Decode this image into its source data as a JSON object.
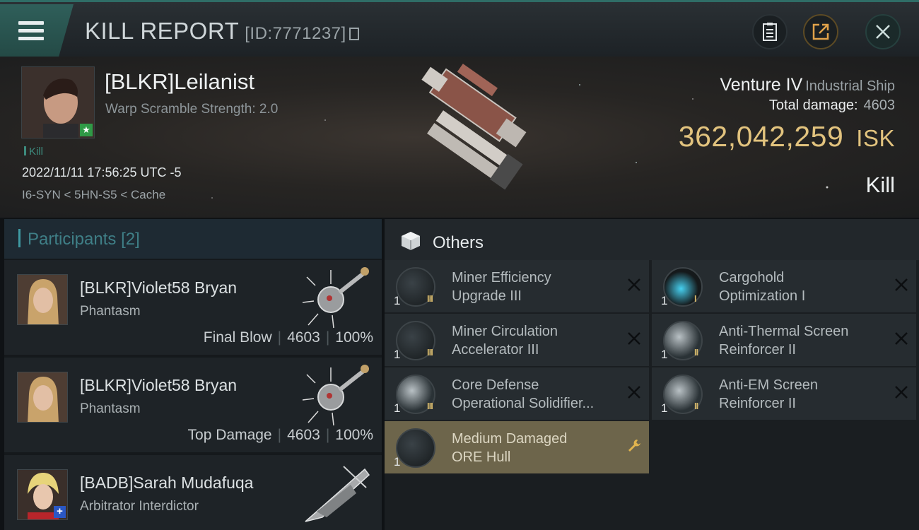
{
  "header": {
    "title": "KILL REPORT",
    "id_label": "[ID:7771237]"
  },
  "victim": {
    "name": "[BLKR]Leilanist",
    "warp_scramble": "Warp Scramble Strength: 2.0",
    "tag": "Kill",
    "datetime": "2022/11/11 17:56:25 UTC -5",
    "location": "I6-SYN < 5HN-S5 < Cache"
  },
  "ship": {
    "name": "Venture IV",
    "class": "Industrial Ship",
    "total_damage_label": "Total damage:",
    "total_damage": "4603",
    "isk_value": "362,042,259",
    "isk_unit": "ISK",
    "result": "Kill"
  },
  "participants": {
    "title": "Participants",
    "count": "[2]",
    "list": [
      {
        "name": "[BLKR]Violet58 Bryan",
        "ship": "Phantasm",
        "role": "Final Blow",
        "damage": "4603",
        "percent": "100%"
      },
      {
        "name": "[BLKR]Violet58 Bryan",
        "ship": "Phantasm",
        "role": "Top Damage",
        "damage": "4603",
        "percent": "100%"
      },
      {
        "name": "[BADB]Sarah Mudafuqa",
        "ship": "Arbitrator Interdictor"
      }
    ]
  },
  "others": {
    "title": "Others",
    "items": [
      {
        "line1": "Miner Efficiency",
        "line2": "Upgrade III",
        "qty": "1"
      },
      {
        "line1": "Cargohold",
        "line2": "Optimization I",
        "qty": "1"
      },
      {
        "line1": "Miner Circulation",
        "line2": "Accelerator III",
        "qty": "1"
      },
      {
        "line1": "Anti-Thermal Screen",
        "line2": "Reinforcer II",
        "qty": "1"
      },
      {
        "line1": "Core Defense",
        "line2": "Operational Solidifier...",
        "qty": "1"
      },
      {
        "line1": "Anti-EM Screen",
        "line2": "Reinforcer II",
        "qty": "1"
      },
      {
        "line1": "Medium Damaged",
        "line2": "ORE Hull",
        "qty": "1"
      }
    ]
  },
  "colors": {
    "accent_teal": "#2f6d66",
    "isk_gold": "#e2c37e",
    "damaged_item_bg": "#6d654b"
  },
  "icons": [
    "menu-icon",
    "copy-icon",
    "clipboard-icon",
    "share-icon",
    "close-icon",
    "cube-icon",
    "wrench-icon",
    "remove-icon"
  ]
}
